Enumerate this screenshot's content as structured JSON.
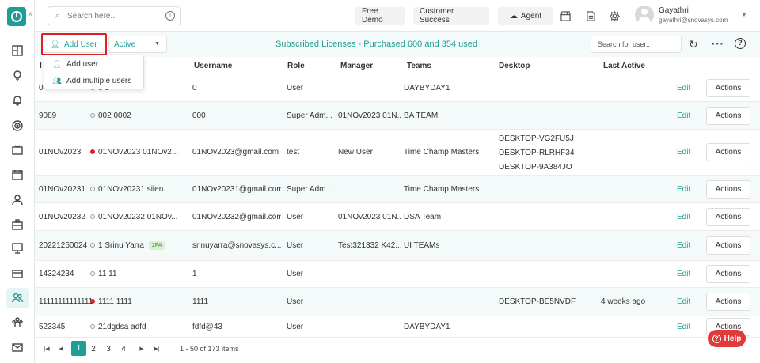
{
  "topbar": {
    "search_placeholder": "Search here...",
    "info_glyph": "i",
    "free_demo": "Free Demo",
    "customer_success": "Customer Success",
    "agent": "Agent",
    "user_name": "Gayathri",
    "user_email": "gayathri@snovasys.com"
  },
  "toolbar": {
    "add_user": "Add User",
    "status": "Active",
    "licenses": "Subscribed Licenses - Purchased 600 and 354 used",
    "user_search_placeholder": "Search for user..",
    "help_glyph": "?"
  },
  "dropdown": {
    "add_user": "Add user",
    "add_multiple": "Add multiple users"
  },
  "columns": {
    "id": "I",
    "username": "Username",
    "role": "Role",
    "manager": "Manager",
    "teams": "Teams",
    "desktop": "Desktop",
    "last_active": "Last Active"
  },
  "rows": [
    {
      "id": "0",
      "name": "0 0",
      "status": "none",
      "username": "0",
      "role": "User",
      "manager": "",
      "teams": "DAYBYDAY1",
      "desktops": [],
      "last_active": "",
      "tfa": ""
    },
    {
      "id": "9089",
      "name": "002 0002",
      "status": "none",
      "username": "000",
      "role": "Super Adm...",
      "manager": "01NOv2023 01N...",
      "teams": "BA TEAM",
      "desktops": [],
      "last_active": "",
      "tfa": ""
    },
    {
      "id": "01NOv2023",
      "name": "01NOv2023 01NOv2...",
      "status": "red",
      "username": "01NOv2023@gmail.com",
      "role": "test",
      "manager": "New User",
      "teams": "Time Champ Masters",
      "desktops": [
        "DESKTOP-VG2FU5J",
        "DESKTOP-RLRHF34",
        "DESKTOP-9A384JO"
      ],
      "last_active": "",
      "tfa": ""
    },
    {
      "id": "01NOv20231",
      "name": "01NOv20231 silen...",
      "status": "none",
      "username": "01NOv20231@gmail.com",
      "role": "Super Adm...",
      "manager": "",
      "teams": "Time Champ Masters",
      "desktops": [],
      "last_active": "",
      "tfa": ""
    },
    {
      "id": "01NOv20232",
      "name": "01NOv20232 01NOv...",
      "status": "none",
      "username": "01NOv20232@gmail.com",
      "role": "User",
      "manager": "01NOv2023 01N...",
      "teams": "DSA Team",
      "desktops": [],
      "last_active": "",
      "tfa": ""
    },
    {
      "id": "20221250024",
      "name": "1 Srinu Yarra",
      "status": "none",
      "username": "srinuyarra@snovasys.c...",
      "role": "User",
      "manager": "Test321332 K42...",
      "teams": "UI TEAMs",
      "desktops": [],
      "last_active": "",
      "tfa": "2FA"
    },
    {
      "id": "14324234",
      "name": "11 11",
      "status": "none",
      "username": "1",
      "role": "User",
      "manager": "",
      "teams": "",
      "desktops": [],
      "last_active": "",
      "tfa": ""
    },
    {
      "id": "11111111111111111",
      "name": "1111 1111",
      "status": "red",
      "username": "1111",
      "role": "User",
      "manager": "",
      "teams": "",
      "desktops": [
        "DESKTOP-BE5NVDF"
      ],
      "last_active": "4 weeks ago",
      "tfa": ""
    },
    {
      "id": "523345",
      "name": "21dgdsa adfd",
      "status": "none",
      "username": "fdfd@43",
      "role": "User",
      "manager": "",
      "teams": "DAYBYDAY1",
      "desktops": [],
      "last_active": "",
      "tfa": ""
    }
  ],
  "row_action_edit": "Edit",
  "row_action_actions": "Actions",
  "pagination": {
    "pages": [
      "1",
      "2",
      "3",
      "4"
    ],
    "current": "1",
    "info": "1 - 50 of 173 items"
  },
  "help_button": "Help",
  "colors": {
    "accent": "#1f9e95",
    "highlight": "#e02020",
    "help": "#e03a3a"
  }
}
